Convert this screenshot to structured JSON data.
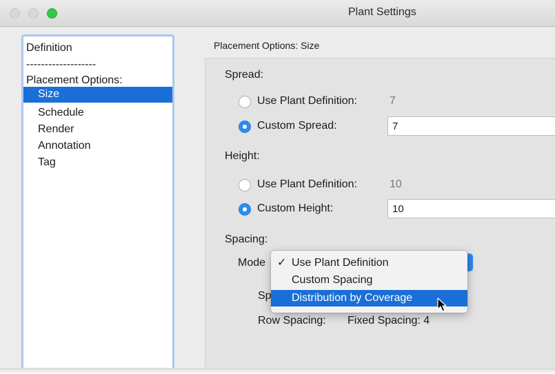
{
  "window": {
    "title": "Plant Settings"
  },
  "sidebar": {
    "items": [
      {
        "label": "Definition",
        "selected": false
      },
      {
        "label": "-------------------",
        "selected": false
      },
      {
        "label": "Placement Options:",
        "selected": false
      },
      {
        "label": "Size",
        "selected": true
      },
      {
        "label": "Schedule",
        "selected": false
      },
      {
        "label": "Render",
        "selected": false
      },
      {
        "label": "Annotation",
        "selected": false
      },
      {
        "label": "Tag",
        "selected": false
      }
    ]
  },
  "panel": {
    "title": "Placement Options: Size",
    "spread": {
      "heading": "Spread:",
      "use_label": "Use Plant Definition:",
      "use_value": "7",
      "custom_label": "Custom Spread:",
      "custom_value": "7"
    },
    "height": {
      "heading": "Height:",
      "use_label": "Use Plant Definition:",
      "use_value": "10",
      "custom_label": "Custom Height:",
      "custom_value": "10"
    },
    "spacing": {
      "heading": "Spacing:",
      "mode_label": "Mode",
      "hidden_label_fragment": "Sp",
      "row_spacing_label": "Row Spacing:",
      "row_spacing_value": "Fixed Spacing: 4"
    }
  },
  "menu": {
    "check_mark": "✓",
    "items": [
      {
        "label": "Use Plant Definition",
        "checked": true,
        "highlighted": false
      },
      {
        "label": "Custom Spacing",
        "checked": false,
        "highlighted": false
      },
      {
        "label": "Distribution by Coverage",
        "checked": false,
        "highlighted": true
      }
    ]
  },
  "colors": {
    "accent": "#1a6fd6",
    "radio_on": "#2f8cf0",
    "sidebar_border": "#a9c8f1"
  }
}
